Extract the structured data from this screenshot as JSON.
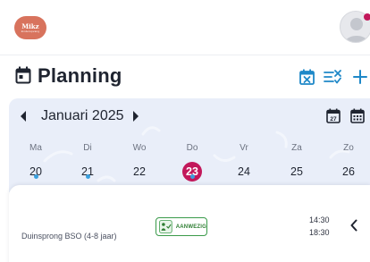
{
  "header": {
    "logo_line1": "Mikz",
    "logo_line2": "kinderopvang"
  },
  "page": {
    "title": "Planning"
  },
  "calendar": {
    "month_label": "Januari 2025",
    "days": [
      {
        "name": "Ma",
        "date": "20",
        "has_dot": true,
        "selected": false
      },
      {
        "name": "Di",
        "date": "21",
        "has_dot": true,
        "selected": false
      },
      {
        "name": "Wo",
        "date": "22",
        "has_dot": false,
        "selected": false
      },
      {
        "name": "Do",
        "date": "23",
        "has_dot": true,
        "selected": true
      },
      {
        "name": "Vr",
        "date": "24",
        "has_dot": false,
        "selected": false
      },
      {
        "name": "Za",
        "date": "25",
        "has_dot": false,
        "selected": false
      },
      {
        "name": "Zo",
        "date": "26",
        "has_dot": false,
        "selected": false
      }
    ]
  },
  "booking": {
    "location": "Duinsprong BSO (4-8 jaar)",
    "status": "AANWEZIG",
    "start_time": "14:30",
    "end_time": "18:30"
  },
  "colors": {
    "accent": "#c2185b",
    "primary": "#1e88c8",
    "calendar_bg": "#e9eef9",
    "status_green": "#2e7d32",
    "dot_blue": "#3aa0de",
    "logo": "#d8735d"
  },
  "icons": {
    "page": "calendar-icon",
    "toolbar": [
      "calendar-x-icon",
      "list-check-icon",
      "plus-icon"
    ],
    "month_nav": [
      "caret-left-icon",
      "caret-right-icon"
    ],
    "views": [
      "calendar-day-icon",
      "calendar-month-icon"
    ],
    "badge": "child-checkin-icon",
    "row": "chevron-left-icon"
  }
}
